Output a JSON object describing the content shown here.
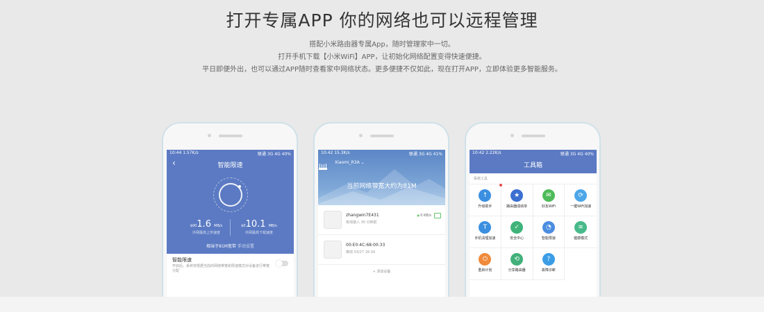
{
  "header": {
    "title": "打开专属APP 你的网络也可以远程管理",
    "lines": [
      "搭配小米路由器专属App，随时管理家中一切。",
      "打开手机下载【小米WiFi】APP，让初始化网络配置变得快速便捷。",
      "平日即便外出，也可以通过APP随时查看家中网络状态。更多便捷不仅如此，现在打开APP，立即体验更多智能服务。"
    ]
  },
  "phone1": {
    "status_left": "10:44   1.57K/s",
    "status_right": "联通 3G  4G  40%",
    "title": "智能限速",
    "back": "‹",
    "upload_prefix": "$",
    "upload_small": "00",
    "upload_value": "1.6",
    "upload_unit": "MB/s",
    "upload_label": "外网最高上传速度",
    "download_prefix": "$",
    "download_small": "0",
    "download_value": "10.1",
    "download_unit": "MB/s",
    "download_label": "外网最高下载速度",
    "hint": "相当于81M宽带",
    "hint_link": "手动设置",
    "setting_title": "智能限速",
    "setting_desc": "开启后，系统将根据当前的网络带宽和限速模式对设备进行带宽分配"
  },
  "phone2": {
    "status_left": "10:42   15.3K/s",
    "status_right": "联通 3G  4G  41%",
    "router_name": "Xiaomi_R3A",
    "headline": "当前网络带宽大约为81M",
    "devices": [
      {
        "name": "zhangwin7E431",
        "meta": "有线接入   30 分钟前",
        "speed": "0 KB/s"
      },
      {
        "name": "00:E0:4C:68:00:33",
        "meta": "离线   03/27 16:34",
        "speed": ""
      }
    ],
    "add_device": "+ 添加设备"
  },
  "phone3": {
    "status_left": "10:42   2.22K/s",
    "status_right": "联通 3G  4G  40%",
    "title": "工具箱",
    "section": "系统工具",
    "tools": [
      {
        "label": "升级助手",
        "icon": "upload-arrow-icon",
        "glyph": "↑",
        "color": "#3b8fe0"
      },
      {
        "label": "路由器成绩单",
        "icon": "medal-icon",
        "glyph": "★",
        "color": "#3b6fd0"
      },
      {
        "label": "好友WiFi",
        "icon": "chat-icon",
        "glyph": "✉",
        "color": "#4fbb5a"
      },
      {
        "label": "一键WiFi加速",
        "icon": "wifi-boost-icon",
        "glyph": "⟳",
        "color": "#4da6e8"
      },
      {
        "label": "手机清理加速",
        "icon": "clean-icon",
        "glyph": "T",
        "color": "#3b8fe0"
      },
      {
        "label": "安全中心",
        "icon": "shield-icon",
        "glyph": "✓",
        "color": "#3fb37a"
      },
      {
        "label": "智能限速",
        "icon": "speed-limit-icon",
        "glyph": "◔",
        "color": "#4b8de0"
      },
      {
        "label": "健康模式",
        "icon": "health-wifi-icon",
        "glyph": "≋",
        "color": "#47b98a"
      },
      {
        "label": "重启计划",
        "icon": "restart-icon",
        "glyph": "⏻",
        "color": "#f08a3a"
      },
      {
        "label": "分享路由器",
        "icon": "share-icon",
        "glyph": "⟲",
        "color": "#42b07a"
      },
      {
        "label": "故障诊断",
        "icon": "question-icon",
        "glyph": "?",
        "color": "#3b9de6"
      }
    ]
  }
}
